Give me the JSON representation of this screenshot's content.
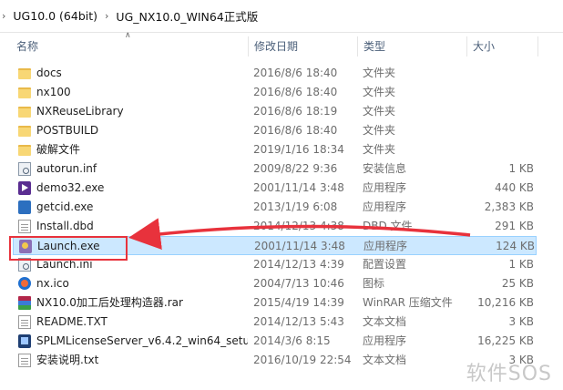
{
  "breadcrumb": {
    "items": [
      "UG10.0 (64bit)",
      "UG_NX10.0_WIN64正式版"
    ]
  },
  "columns": {
    "name": "名称",
    "date": "修改日期",
    "type": "类型",
    "size": "大小"
  },
  "files": [
    {
      "name": "docs",
      "date": "2016/8/6 18:40",
      "type": "文件夹",
      "size": "",
      "icon": "folder-icon"
    },
    {
      "name": "nx100",
      "date": "2016/8/6 18:40",
      "type": "文件夹",
      "size": "",
      "icon": "folder-icon"
    },
    {
      "name": "NXReuseLibrary",
      "date": "2016/8/6 18:19",
      "type": "文件夹",
      "size": "",
      "icon": "folder-icon"
    },
    {
      "name": "POSTBUILD",
      "date": "2016/8/6 18:40",
      "type": "文件夹",
      "size": "",
      "icon": "folder-icon"
    },
    {
      "name": "破解文件",
      "date": "2019/1/16 18:34",
      "type": "文件夹",
      "size": "",
      "icon": "folder-icon"
    },
    {
      "name": "autorun.inf",
      "date": "2009/8/22 9:36",
      "type": "安装信息",
      "size": "1 KB",
      "icon": "settings-file-icon"
    },
    {
      "name": "demo32.exe",
      "date": "2001/11/14 3:48",
      "type": "应用程序",
      "size": "440 KB",
      "icon": "play-app-icon"
    },
    {
      "name": "getcid.exe",
      "date": "2013/1/19 6:08",
      "type": "应用程序",
      "size": "2,383 KB",
      "icon": "app-icon"
    },
    {
      "name": "Install.dbd",
      "date": "2014/12/13 4:38",
      "type": "DBD 文件",
      "size": "291 KB",
      "icon": "document-icon"
    },
    {
      "name": "Launch.exe",
      "date": "2001/11/14 3:48",
      "type": "应用程序",
      "size": "124 KB",
      "icon": "launcher-app-icon"
    },
    {
      "name": "Launch.ini",
      "date": "2014/12/13 4:39",
      "type": "配置设置",
      "size": "1 KB",
      "icon": "config-file-icon"
    },
    {
      "name": "nx.ico",
      "date": "2004/7/13 10:46",
      "type": "图标",
      "size": "25 KB",
      "icon": "image-icon"
    },
    {
      "name": "NX10.0加工后处理构造器.rar",
      "date": "2015/4/19 14:39",
      "type": "WinRAR 压缩文件",
      "size": "10,216 KB",
      "icon": "archive-icon"
    },
    {
      "name": "README.TXT",
      "date": "2014/12/13 5:43",
      "type": "文本文档",
      "size": "3 KB",
      "icon": "text-file-icon"
    },
    {
      "name": "SPLMLicenseServer_v6.4.2_win64_setu...",
      "date": "2014/3/6 8:15",
      "type": "应用程序",
      "size": "16,225 KB",
      "icon": "server-app-icon"
    },
    {
      "name": "安装说明.txt",
      "date": "2016/10/19 22:54",
      "type": "文本文档",
      "size": "3 KB",
      "icon": "text-file-icon"
    }
  ],
  "selected_index": 9,
  "watermark": "软件SOS",
  "colors": {
    "selection_bg": "#cce8ff",
    "selection_border": "#99d1ff",
    "annotation_red": "#e8323c",
    "header_text": "#4c607a"
  }
}
